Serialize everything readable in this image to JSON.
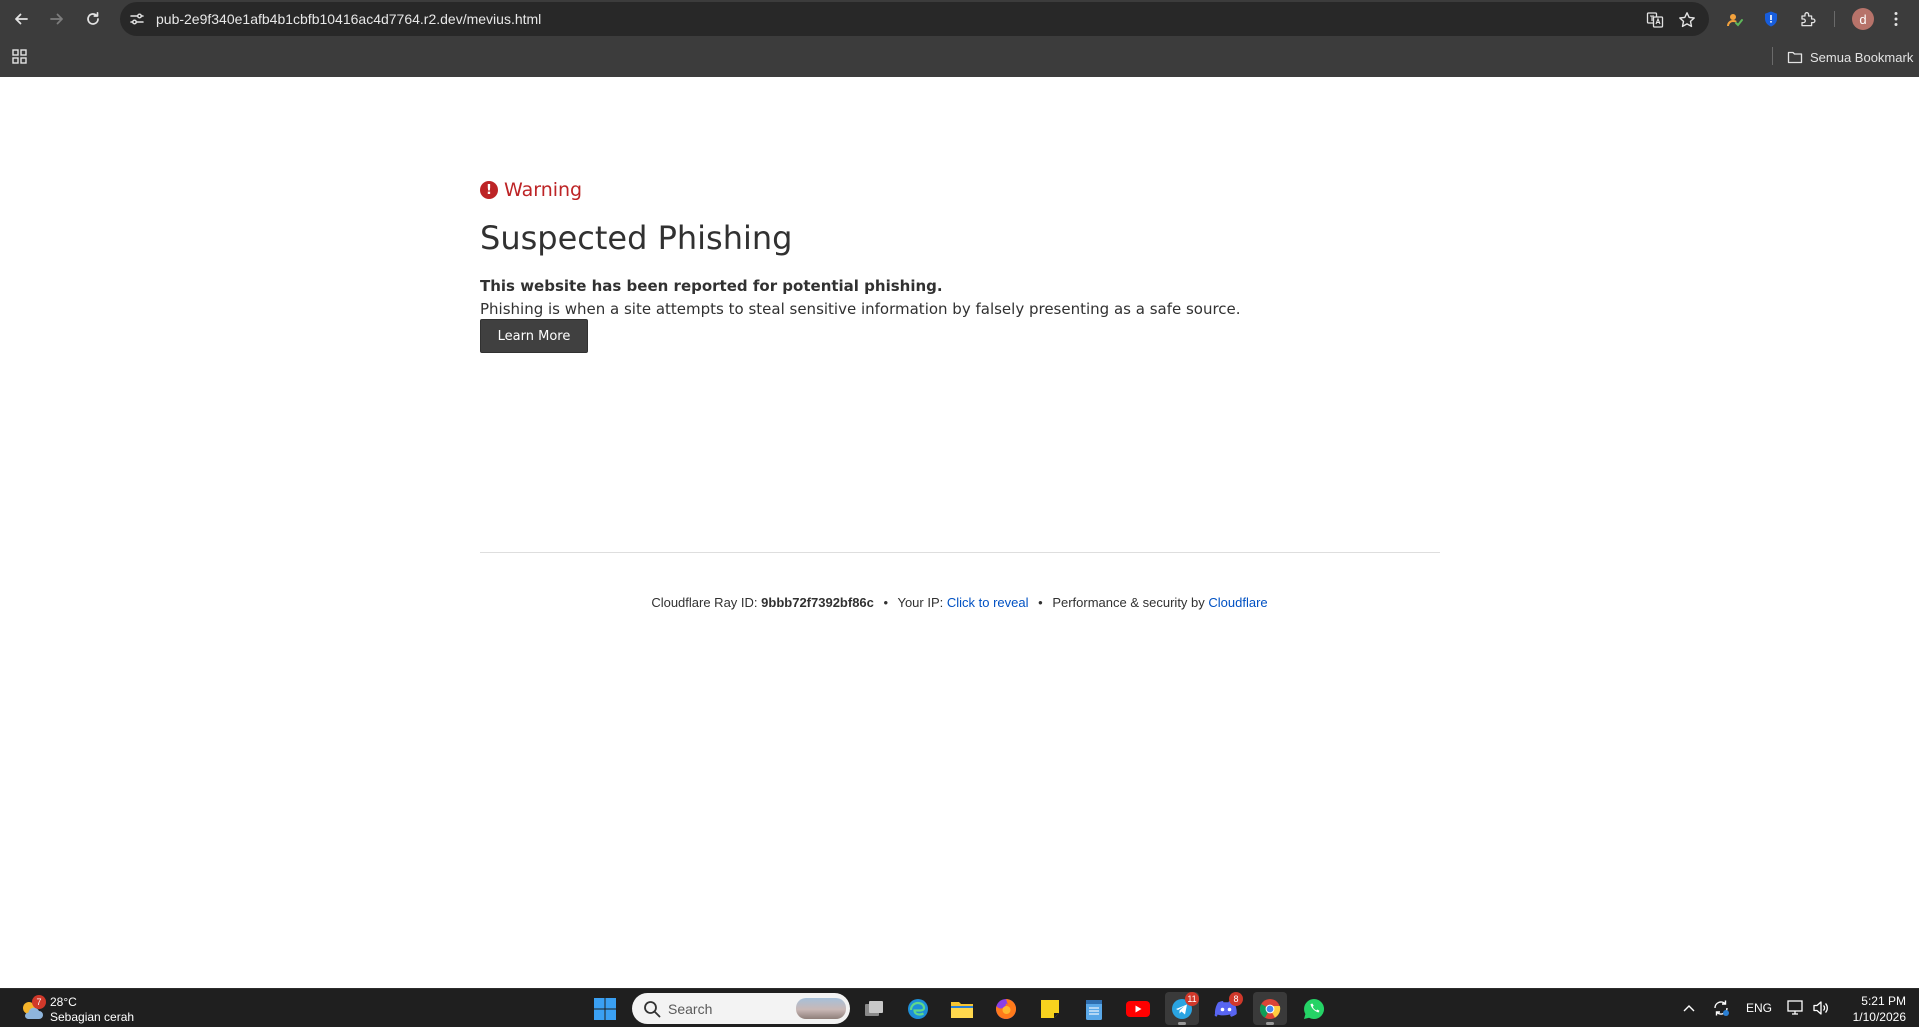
{
  "browser": {
    "url": "pub-2e9f340e1afb4b1cbfb10416ac4d7764.r2.dev/mevius.html",
    "profile_initial": "d",
    "all_bookmarks_label": "Semua Bookmark"
  },
  "page": {
    "warning_label": "Warning",
    "headline": "Suspected Phishing",
    "subtitle": "This website has been reported for potential phishing.",
    "description": "Phishing is when a site attempts to steal sensitive information by falsely presenting as a safe source.",
    "learn_more_label": "Learn More",
    "accent_color": "#bd2426",
    "link_color": "#0051c3"
  },
  "footer": {
    "ray_prefix": "Cloudflare Ray ID:",
    "ray_id": "9bbb72f7392bf86c",
    "dot": "•",
    "ip_prefix": "Your IP:",
    "ip_link": "Click to reveal",
    "perf_prefix": "Performance & security by",
    "perf_link": "Cloudflare"
  },
  "taskbar": {
    "weather_badge": "7",
    "weather_temp": "28°C",
    "weather_condition": "Sebagian cerah",
    "search_label": "Search",
    "telegram_badge": "11",
    "discord_badge": "8",
    "language": "ENG",
    "time": "5:21 PM",
    "date": "1/10/2026"
  }
}
